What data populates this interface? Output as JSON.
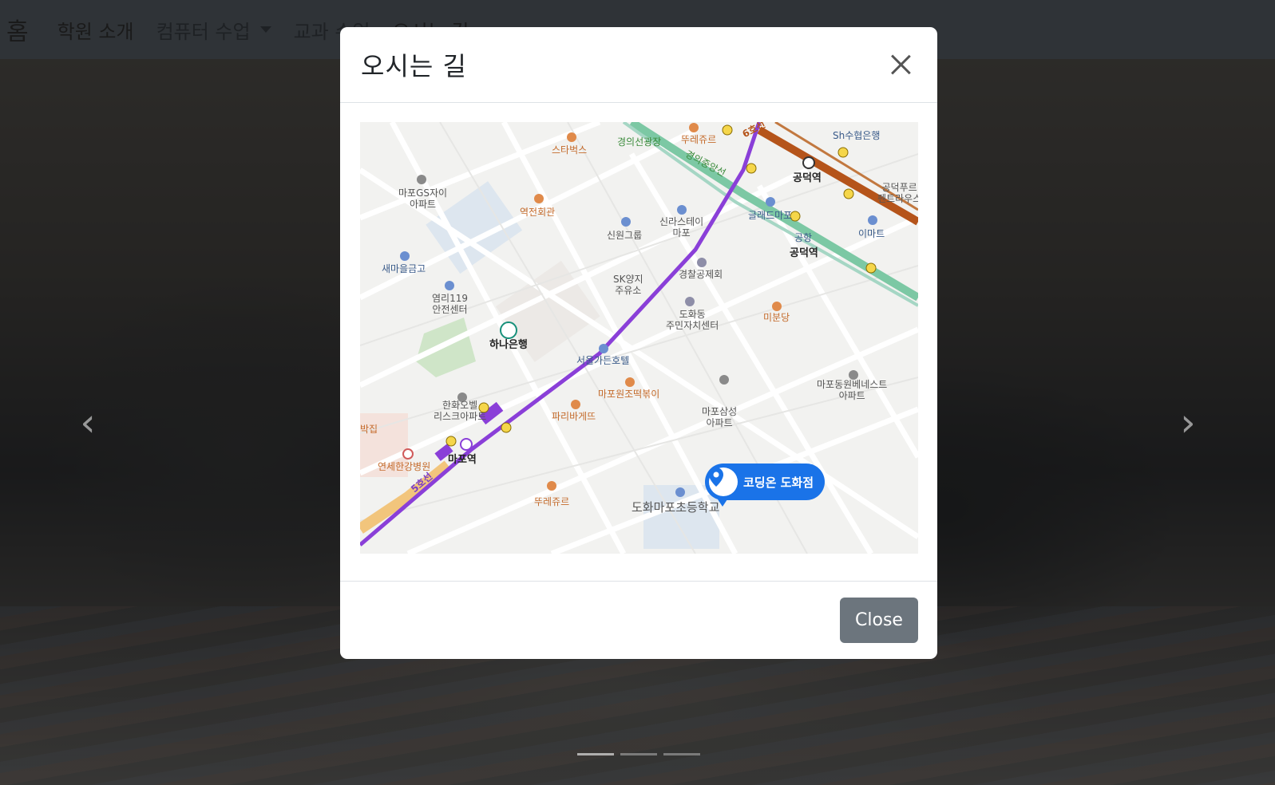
{
  "navbar": {
    "brand": "홈",
    "items": [
      {
        "label": "학원 소개"
      },
      {
        "label": "컴퓨터 수업"
      },
      {
        "label": "교과 수업"
      },
      {
        "label": "오시는 길"
      }
    ]
  },
  "carousel": {
    "prev_icon": "chevron-left-icon",
    "next_icon": "chevron-right-icon",
    "slides": 3,
    "active_index": 0
  },
  "modal": {
    "title": "오시는 길",
    "close_label": "Close",
    "map": {
      "pin_label": "코딩온 도화점",
      "places": [
        {
          "name": "마포GS자이\n아파트"
        },
        {
          "name": "스타벅스"
        },
        {
          "name": "경의선광장"
        },
        {
          "name": "뚜레쥬르"
        },
        {
          "name": "6호선"
        },
        {
          "name": "Sh수협은행"
        },
        {
          "name": "역전회관"
        },
        {
          "name": "신원그룹"
        },
        {
          "name": "신라스테이\n마포"
        },
        {
          "name": "경의중앙선"
        },
        {
          "name": "공덕역"
        },
        {
          "name": "글래드마포"
        },
        {
          "name": "공덕푸르\n펜트라우스"
        },
        {
          "name": "이마트"
        },
        {
          "name": "새마을금고"
        },
        {
          "name": "SK양지\n주유소"
        },
        {
          "name": "경찰공제회"
        },
        {
          "name": "공항"
        },
        {
          "name": "공덕역"
        },
        {
          "name": "염리119\n안전센터"
        },
        {
          "name": "도화동\n주민자치센터"
        },
        {
          "name": "미분당"
        },
        {
          "name": "하나은행"
        },
        {
          "name": "서울가든호텔"
        },
        {
          "name": "마포원조떡볶이"
        },
        {
          "name": "마포동원베네스트\n아파트"
        },
        {
          "name": "한화오벨\n리스크아파트"
        },
        {
          "name": "파리바게뜨"
        },
        {
          "name": "마포삼성\n아파트"
        },
        {
          "name": "연세한강병원"
        },
        {
          "name": "마포역"
        },
        {
          "name": "5호선"
        },
        {
          "name": "뚜레쥬르"
        },
        {
          "name": "도화마포초등학교"
        },
        {
          "name": "박집"
        }
      ]
    }
  }
}
